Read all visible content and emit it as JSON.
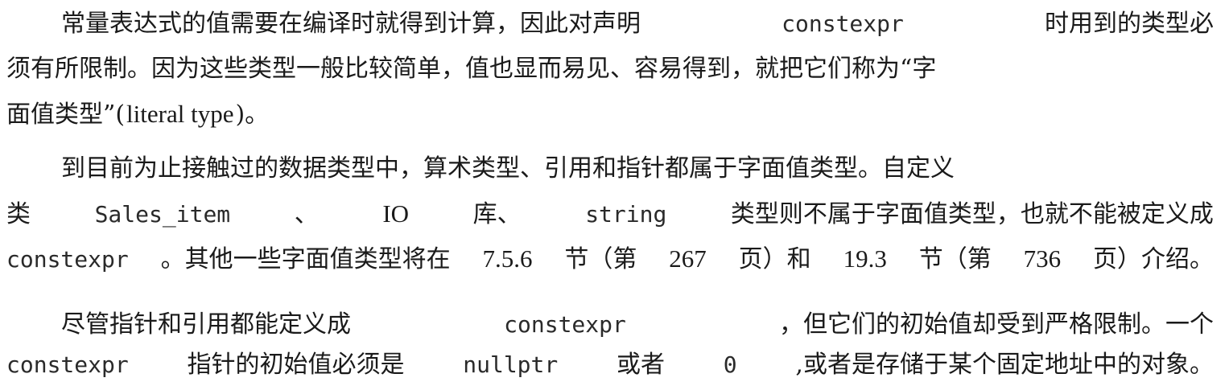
{
  "paragraphs": [
    {
      "lines": [
        [
          {
            "t": "常量表达式的值需要在编译时就得到计算，因此对声明",
            "k": "text"
          },
          {
            "t": "constexpr",
            "k": "code"
          },
          {
            "t": "时用到的类型必",
            "k": "text"
          }
        ],
        [
          {
            "t": "须有所限制。因为这些类型一般比较简单，值也显而易见、容易得到，就把它们称为“字",
            "k": "text"
          }
        ],
        [
          {
            "t": "面值类型”(",
            "k": "text"
          },
          {
            "t": "literal type",
            "k": "latin"
          },
          {
            "t": ")。",
            "k": "text"
          }
        ]
      ]
    },
    {
      "lines": [
        [
          {
            "t": "到目前为止接触过的数据类型中，算术类型、引用和指针都属于字面值类型。自定义",
            "k": "text"
          }
        ],
        [
          {
            "t": "类",
            "k": "text"
          },
          {
            "t": "Sales_item",
            "k": "code"
          },
          {
            "t": "、",
            "k": "text"
          },
          {
            "t": "IO",
            "k": "latin"
          },
          {
            "t": "库、",
            "k": "text"
          },
          {
            "t": "string",
            "k": "code"
          },
          {
            "t": "类型则不属于字面值类型，也就不能被定义成",
            "k": "text"
          }
        ],
        [
          {
            "t": "constexpr",
            "k": "code"
          },
          {
            "t": "。其他一些字面值类型将在",
            "k": "text"
          },
          {
            "t": "7.5.6",
            "k": "latin"
          },
          {
            "t": "节（第",
            "k": "text"
          },
          {
            "t": "267",
            "k": "latin"
          },
          {
            "t": "页）和",
            "k": "text"
          },
          {
            "t": "19.3",
            "k": "latin"
          },
          {
            "t": "节（第",
            "k": "text"
          },
          {
            "t": "736",
            "k": "latin"
          },
          {
            "t": "页）介绍。",
            "k": "text"
          }
        ]
      ]
    },
    {
      "lines": [
        [
          {
            "t": "尽管指针和引用都能定义成",
            "k": "text"
          },
          {
            "t": "constexpr",
            "k": "code"
          },
          {
            "t": "，但它们的初始值却受到严格限制。一个",
            "k": "text"
          }
        ],
        [
          {
            "t": "constexpr",
            "k": "code"
          },
          {
            "t": "指针的初始值必须是",
            "k": "text"
          },
          {
            "t": "nullptr",
            "k": "code"
          },
          {
            "t": "或者",
            "k": "text"
          },
          {
            "t": "0",
            "k": "code"
          },
          {
            "t": ",或者是存储于某个固定地址中的对象。",
            "k": "text"
          }
        ]
      ]
    }
  ]
}
